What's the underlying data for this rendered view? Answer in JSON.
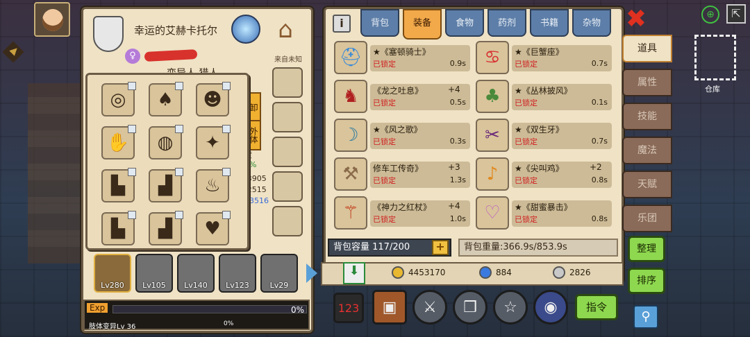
{
  "character": {
    "title": "幸运的艾赫卡托尔",
    "gender_symbol": "♀",
    "origin": "来自未知",
    "subtitle_partial": "变异人 猎人",
    "badges": [
      "卸",
      "外体"
    ],
    "stats_partial": [
      "度",
      "2%",
      "/3905",
      "/2515",
      "13516"
    ]
  },
  "equipped_grid": [
    {
      "name": "ring-blue",
      "glyph": "◎"
    },
    {
      "name": "armor-white",
      "glyph": "♠"
    },
    {
      "name": "pumpkin",
      "glyph": "☻"
    },
    {
      "name": "glove-purple",
      "glyph": "✋"
    },
    {
      "name": "belt",
      "glyph": "◍"
    },
    {
      "name": "shoulder-dark",
      "glyph": "✦"
    },
    {
      "name": "boots-gray",
      "glyph": "▙"
    },
    {
      "name": "boots-red",
      "glyph": "▟"
    },
    {
      "name": "boots-fire",
      "glyph": "♨"
    },
    {
      "name": "boots-brown",
      "glyph": "▙"
    },
    {
      "name": "boots-white",
      "glyph": "▟"
    },
    {
      "name": "empty-chest",
      "glyph": "♥"
    }
  ],
  "heroes": [
    {
      "level": "Lv280",
      "selected": true
    },
    {
      "level": "Lv105",
      "selected": false
    },
    {
      "level": "Lv140",
      "selected": false
    },
    {
      "level": "Lv123",
      "selected": false
    },
    {
      "level": "Lv29",
      "selected": false
    }
  ],
  "exp": {
    "label": "Exp",
    "percent": "0%",
    "sub_label": "肢体变异Lv 36",
    "sub_percent": "0%"
  },
  "tabs": [
    "背包",
    "装备",
    "食物",
    "药剂",
    "书籍",
    "杂物"
  ],
  "active_tab": "装备",
  "info_label": "i",
  "items": [
    {
      "name": "★《塞顿骑士》",
      "plus": "",
      "locked": "已锁定",
      "weight": "0.9s",
      "glyph": "⛑",
      "color": "#3a8ad8"
    },
    {
      "name": "★《巨蟹座》",
      "plus": "",
      "locked": "已锁定",
      "weight": "0.7s",
      "glyph": "♋",
      "color": "#d83030"
    },
    {
      "name": "《龙之吐息》",
      "plus": "+4",
      "locked": "已锁定",
      "weight": "0.5s",
      "glyph": "♞",
      "color": "#b02020"
    },
    {
      "name": "★《丛林披风》",
      "plus": "",
      "locked": "已锁定",
      "weight": "0.1s",
      "glyph": "♣",
      "color": "#4a8a3a"
    },
    {
      "name": "★《风之歌》",
      "plus": "",
      "locked": "已锁定",
      "weight": "0.3s",
      "glyph": "☽",
      "color": "#2a7aa0"
    },
    {
      "name": "★《双生牙》",
      "plus": "",
      "locked": "已锁定",
      "weight": "0.7s",
      "glyph": "✂",
      "color": "#6a2a7a"
    },
    {
      "name": "修车工传奇》",
      "plus": "+3",
      "locked": "已锁定",
      "weight": "1.3s",
      "glyph": "⚒",
      "color": "#8a6a4a"
    },
    {
      "name": "★《尖叫鸡》",
      "plus": "+2",
      "locked": "已锁定",
      "weight": "0.8s",
      "glyph": "♪",
      "color": "#e08a20"
    },
    {
      "name": "《神力之红杖》",
      "plus": "+4",
      "locked": "已锁定",
      "weight": "1.0s",
      "glyph": "⚚",
      "color": "#c03010"
    },
    {
      "name": "★《甜蜜暴击》",
      "plus": "",
      "locked": "已锁定",
      "weight": "0.8s",
      "glyph": "♡",
      "color": "#c060c0"
    }
  ],
  "capacity": "背包容量 117/200",
  "capacity_add": "+",
  "weight": "背包重量:366.9s/853.9s",
  "currency": [
    {
      "name": "gold",
      "value": "4453170",
      "color": "#e8b830"
    },
    {
      "name": "gem",
      "value": "884",
      "color": "#3a7ae0"
    },
    {
      "name": "silver",
      "value": "2826",
      "color": "#c8c8c8"
    }
  ],
  "command_label": "指令",
  "side_tabs": [
    {
      "label": "道具",
      "active": true
    },
    {
      "label": "属性",
      "active": false
    },
    {
      "label": "技能",
      "active": false
    },
    {
      "label": "魔法",
      "active": false
    },
    {
      "label": "天赋",
      "active": false
    },
    {
      "label": "乐团",
      "active": false
    }
  ],
  "organize_label": "整理",
  "sort_label": "排序",
  "storage_label": "仓库",
  "close_symbol": "✖",
  "search_symbol": "⚲"
}
